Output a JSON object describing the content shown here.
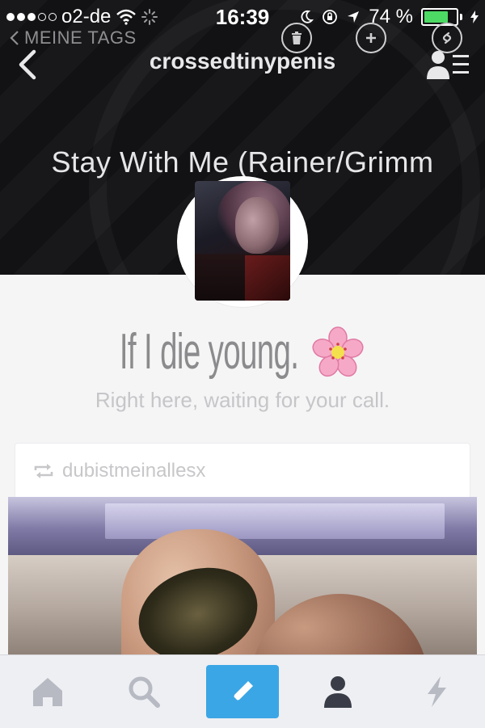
{
  "status_bar": {
    "carrier": "o2-de",
    "time": "16:39",
    "battery": "74 %",
    "battery_level": 0.74
  },
  "nav": {
    "back_label": "MEINE TAGS",
    "blog_name": "crossedtinypenis"
  },
  "blog": {
    "title": "Stay With Me (Rainer/Grimm",
    "headline": "If I die young.",
    "description": "Right here, waiting for your call."
  },
  "post": {
    "reblogged_from": "dubistmeinallesx"
  },
  "colors": {
    "header_bg": "#121214",
    "accent": "#3ba6e5",
    "battery": "#4cd964"
  },
  "icons": {
    "tab_home": "home-icon",
    "tab_search": "search-icon",
    "tab_compose": "pencil-icon",
    "tab_account": "person-icon",
    "tab_activity": "lightning-icon"
  }
}
